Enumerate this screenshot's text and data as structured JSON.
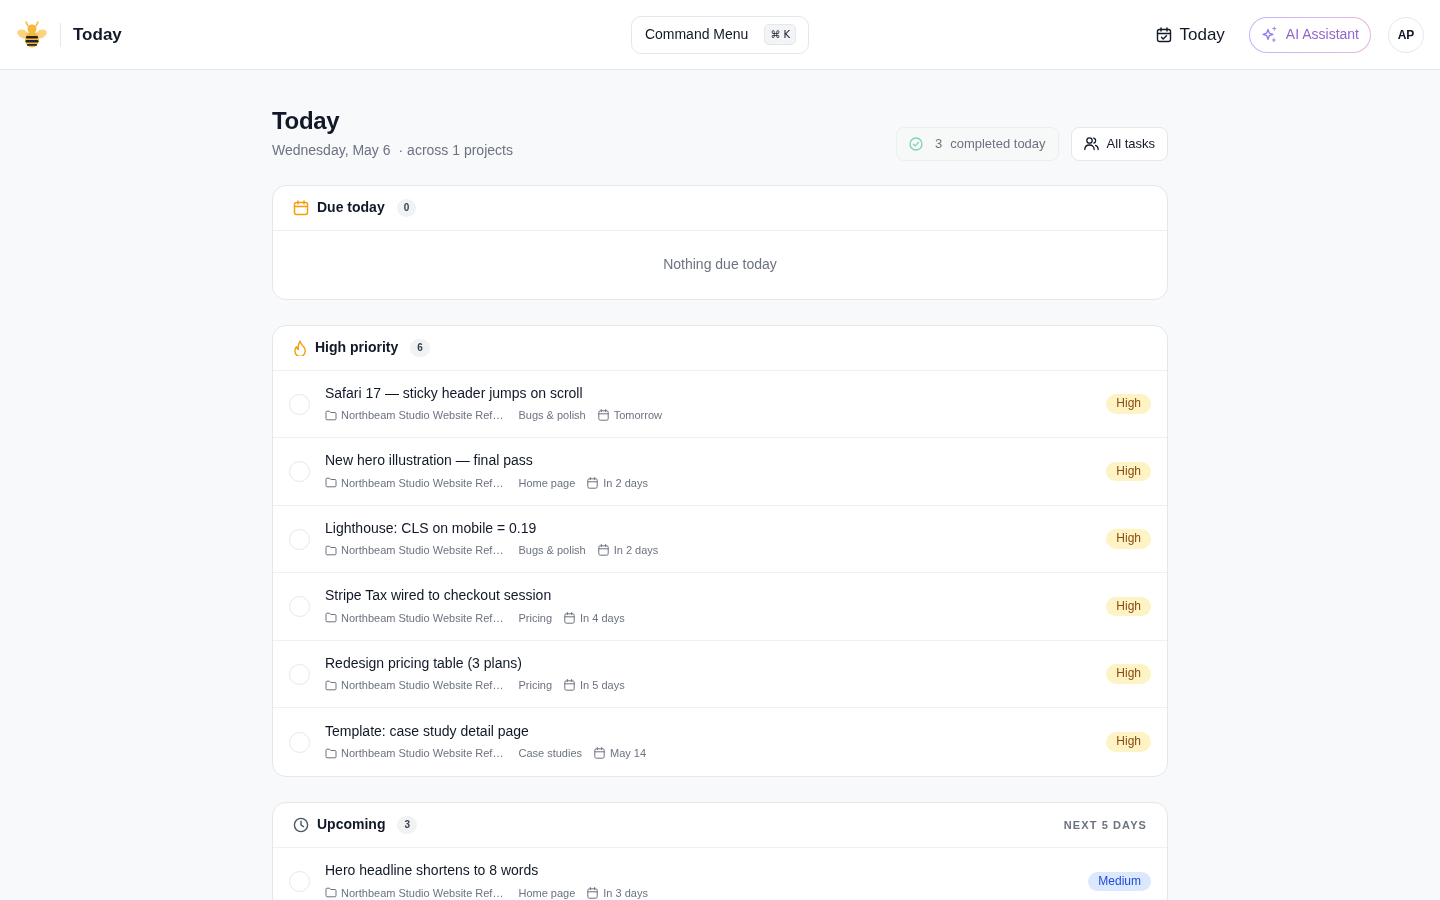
{
  "header": {
    "title": "Today",
    "command_menu": {
      "label": "Command Menu",
      "shortcut": "⌘ K"
    },
    "today_link": "Today",
    "ai_button": "AI Assistant",
    "avatar": "AP"
  },
  "page": {
    "title": "Today",
    "date": "Wednesday, May 6",
    "projects": "· across 1 projects",
    "completed": {
      "count": "3",
      "label": "completed today"
    },
    "all_tasks_button": "All tasks"
  },
  "sections": [
    {
      "kind": "due",
      "title": "Due today",
      "count": "0",
      "empty_text": "Nothing due today"
    },
    {
      "kind": "priority",
      "title": "High priority",
      "count": "6",
      "tasks": [
        {
          "title": "Safari 17 — sticky header jumps on scroll",
          "project": "Northbeam Studio Website Ref…",
          "list": "Bugs & polish",
          "due": "Tomorrow",
          "checked": false,
          "priority": {
            "label": "High",
            "kind": "high"
          }
        },
        {
          "title": "New hero illustration — final pass",
          "project": "Northbeam Studio Website Ref…",
          "list": "Home page",
          "due": "In 2 days",
          "checked": false,
          "priority": {
            "label": "High",
            "kind": "high"
          }
        },
        {
          "title": "Lighthouse: CLS on mobile = 0.19",
          "project": "Northbeam Studio Website Ref…",
          "list": "Bugs & polish",
          "due": "In 2 days",
          "checked": false,
          "priority": {
            "label": "High",
            "kind": "high"
          }
        },
        {
          "title": "Stripe Tax wired to checkout session",
          "project": "Northbeam Studio Website Ref…",
          "list": "Pricing",
          "due": "In 4 days",
          "checked": false,
          "priority": {
            "label": "High",
            "kind": "high"
          }
        },
        {
          "title": "Redesign pricing table (3 plans)",
          "project": "Northbeam Studio Website Ref…",
          "list": "Pricing",
          "due": "In 5 days",
          "checked": false,
          "priority": {
            "label": "High",
            "kind": "high"
          }
        },
        {
          "title": "Template: case study detail page",
          "project": "Northbeam Studio Website Ref…",
          "list": "Case studies",
          "due": "May 14",
          "checked": false,
          "priority": {
            "label": "High",
            "kind": "high"
          }
        }
      ]
    },
    {
      "kind": "upcoming",
      "title": "Upcoming",
      "count": "3",
      "range": "NEXT 5 DAYS",
      "tasks": [
        {
          "title": "Hero headline shortens to 8 words",
          "project": "Northbeam Studio Website Ref…",
          "list": "Home page",
          "due": "In 3 days",
          "checked": false,
          "priority": {
            "label": "Medium",
            "kind": "medium"
          }
        }
      ]
    }
  ]
}
